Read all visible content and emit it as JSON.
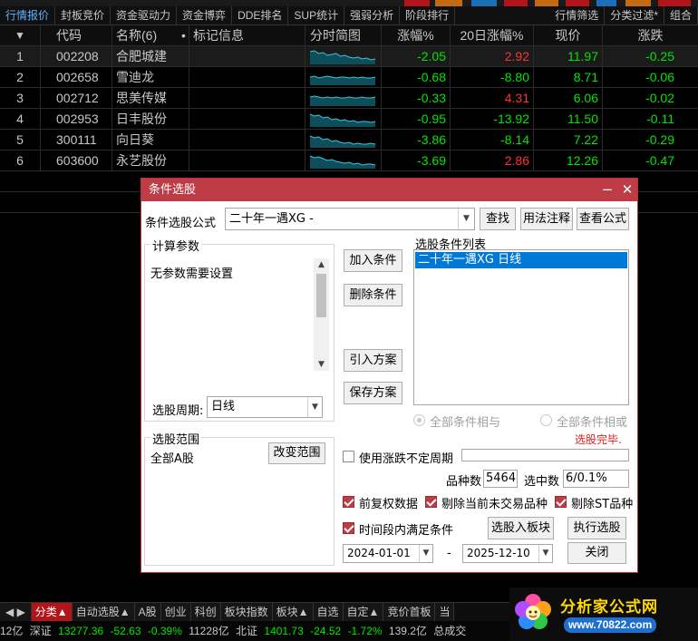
{
  "colors": {
    "up": "#ff3333",
    "down": "#00e600",
    "accent_blue": "#5fb3ff",
    "dialog_red": "#bd3c45",
    "selection_blue": "#0078d7"
  },
  "tabs": {
    "items": [
      "行情报价",
      "封板竞价",
      "资金驱动力",
      "资金博弈",
      "DDE排名",
      "SUP统计",
      "强弱分析",
      "阶段排行"
    ],
    "right": [
      "行情筛选",
      "分类过滤*",
      "组合"
    ]
  },
  "table": {
    "headers": {
      "sort": "▼",
      "code": "代码",
      "name": "名称(6)",
      "dot": "•",
      "note": "标记信息",
      "spark": "分时简图",
      "pct": "涨幅%",
      "pct20": "20日涨幅%",
      "price": "现价",
      "chg": "涨跌"
    },
    "rows": [
      {
        "idx": "1",
        "code": "002208",
        "name": "合肥城建",
        "pct": "-2.05",
        "pct20": "2.92",
        "price": "11.97",
        "chg": "-0.25",
        "pct20_dir": "up",
        "price_dir": "down"
      },
      {
        "idx": "2",
        "code": "002658",
        "name": "雪迪龙",
        "pct": "-0.68",
        "pct20": "-8.80",
        "price": "8.71",
        "chg": "-0.06",
        "pct20_dir": "down",
        "price_dir": "down"
      },
      {
        "idx": "3",
        "code": "002712",
        "name": "思美传媒",
        "pct": "-0.33",
        "pct20": "4.31",
        "price": "6.06",
        "chg": "-0.02",
        "pct20_dir": "up",
        "price_dir": "down"
      },
      {
        "idx": "4",
        "code": "002953",
        "name": "日丰股份",
        "pct": "-0.95",
        "pct20": "-13.92",
        "price": "11.50",
        "chg": "-0.11",
        "pct20_dir": "down",
        "price_dir": "down"
      },
      {
        "idx": "5",
        "code": "300111",
        "name": "向日葵",
        "pct": "-3.86",
        "pct20": "-8.14",
        "price": "7.22",
        "chg": "-0.29",
        "pct20_dir": "down",
        "price_dir": "down"
      },
      {
        "idx": "6",
        "code": "603600",
        "name": "永艺股份",
        "pct": "-3.69",
        "pct20": "2.86",
        "price": "12.26",
        "chg": "-0.47",
        "pct20_dir": "up",
        "price_dir": "down"
      }
    ]
  },
  "dialog": {
    "title": "条件选股",
    "minimize": "−",
    "close": "✕",
    "formula_label": "条件选股公式",
    "formula_value": "二十年一遇XG  -",
    "find": "查找",
    "usage_notes": "用法注释",
    "view_formula": "查看公式",
    "calc_params_title": "计算参数",
    "no_params": "无参数需要设置",
    "period_label": "选股周期:",
    "period_value": "日线",
    "add_condition": "加入条件",
    "delete_condition": "删除条件",
    "import_plan": "引入方案",
    "save_plan": "保存方案",
    "conditions_list_title": "选股条件列表",
    "conditions": [
      "二十年一遇XG  日线"
    ],
    "all_and": "全部条件相与",
    "all_or": "全部条件相或",
    "done": "选股完毕.",
    "range_title": "选股范围",
    "range_value": "全部A股",
    "change_range": "改变范围",
    "use_period": "使用涨跌不定周期",
    "count_label": "品种数",
    "count_value": "5464",
    "selected_label": "选中数",
    "selected_value": "6/0.1%",
    "pre_adjust": "前复权数据",
    "exclude_untraded": "剔除当前未交易品种",
    "exclude_st": "剔除ST品种",
    "time_range": "时间段内满足条件",
    "select_to_block": "选股入板块",
    "execute": "执行选股",
    "date_from": "2024-01-01",
    "date_sep": "-",
    "date_to": "2025-12-10",
    "close_btn": "关闭"
  },
  "bottom_tabs": {
    "nav": "◀ ▶",
    "items": [
      "分类▲",
      "自动选股▲",
      "A股",
      "创业",
      "科创",
      "板块指数",
      "板块▲",
      "自选",
      "自定▲",
      "竞价首板",
      "当"
    ]
  },
  "status": {
    "sz_prefix": "12亿",
    "sz_label": "深证",
    "sz_value": "13277.36",
    "sz_change": "-52.63",
    "sz_pct": "-0.39%",
    "sz_amount": "11228亿",
    "bz_label": "北证",
    "bz_value": "1401.73",
    "bz_change": "-24.52",
    "bz_pct": "-1.72%",
    "bz_amount": "139.2亿",
    "total_label": "总成交"
  },
  "brand": {
    "title": "分析家公式网",
    "url": "www.70822.com"
  }
}
